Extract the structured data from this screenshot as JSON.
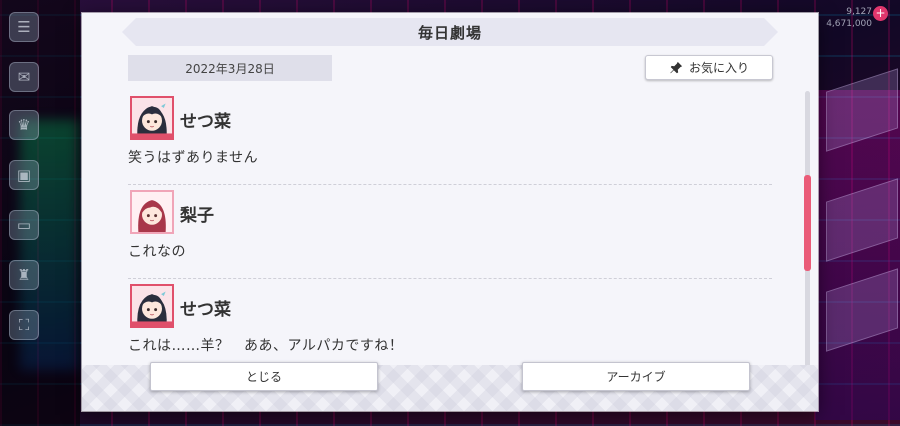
{
  "dialog": {
    "title": "毎日劇場",
    "date": "2022年3月28日",
    "favorite_label": "お気に入り",
    "close_label": "とじる",
    "archive_label": "アーカイブ"
  },
  "entries": [
    {
      "speaker": "せつ菜",
      "line": "笑うはずありません",
      "avatar": "setsuna-avatar"
    },
    {
      "speaker": "梨子",
      "line": "これなの",
      "avatar": "riko-avatar"
    },
    {
      "speaker": "せつ菜",
      "line": "これは……羊？　ああ、アルパカですね！",
      "avatar": "setsuna-avatar"
    }
  ],
  "background": {
    "top_right_values": [
      "9,127",
      "4,671,000"
    ]
  },
  "colors": {
    "accent_pink": "#ea5b78",
    "dialog_bg": "#f5f5fa",
    "title_bar_bg": "#e6e6f1"
  },
  "icons": {
    "favorite": "pin-icon"
  }
}
